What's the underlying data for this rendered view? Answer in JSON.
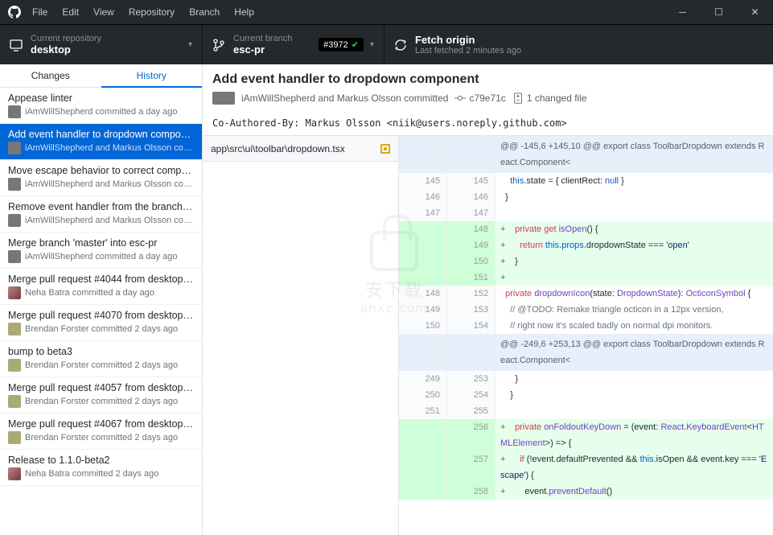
{
  "menu": [
    "File",
    "Edit",
    "View",
    "Repository",
    "Branch",
    "Help"
  ],
  "repo": {
    "label": "Current repository",
    "value": "desktop"
  },
  "branch": {
    "label": "Current branch",
    "value": "esc-pr",
    "pr": "#3972"
  },
  "fetch": {
    "label": "Fetch origin",
    "sub": "Last fetched 2 minutes ago"
  },
  "tabs": {
    "changes": "Changes",
    "history": "History"
  },
  "commits": [
    {
      "title": "Appease linter",
      "meta": "iAmWillShepherd committed a day ago",
      "avatar": "a1"
    },
    {
      "title": "Add event handler to dropdown compon…",
      "meta": "iAmWillShepherd and Markus Olsson co…",
      "avatar": "a1",
      "selected": true
    },
    {
      "title": "Move escape behavior to correct compo…",
      "meta": "iAmWillShepherd and Markus Olsson co…",
      "avatar": "a1"
    },
    {
      "title": "Remove event handler from the branches..",
      "meta": "iAmWillShepherd and Markus Olsson co…",
      "avatar": "a1"
    },
    {
      "title": "Merge branch 'master' into esc-pr",
      "meta": "iAmWillShepherd committed a day ago",
      "avatar": "a1"
    },
    {
      "title": "Merge pull request #4044 from desktop/…",
      "meta": "Neha Batra committed a day ago",
      "avatar": "a2"
    },
    {
      "title": "Merge pull request #4070 from desktop/…",
      "meta": "Brendan Forster committed 2 days ago",
      "avatar": "a3"
    },
    {
      "title": "bump to beta3",
      "meta": "Brendan Forster committed 2 days ago",
      "avatar": "a3"
    },
    {
      "title": "Merge pull request #4057 from desktop/…",
      "meta": "Brendan Forster committed 2 days ago",
      "avatar": "a3"
    },
    {
      "title": "Merge pull request #4067 from desktop/…",
      "meta": "Brendan Forster committed 2 days ago",
      "avatar": "a3"
    },
    {
      "title": "Release to 1.1.0-beta2",
      "meta": "Neha Batra committed 2 days ago",
      "avatar": "a2"
    }
  ],
  "detail": {
    "title": "Add event handler to dropdown component",
    "authors": "iAmWillShepherd and Markus Olsson committed",
    "sha": "c79e71c",
    "changed": "1 changed file",
    "desc": "Co-Authored-By: Markus Olsson <niik@users.noreply.github.com>",
    "file": "app\\src\\ui\\toolbar\\dropdown.tsx"
  },
  "watermark": {
    "txt1": "安下载",
    "txt2": "anxz.com"
  }
}
